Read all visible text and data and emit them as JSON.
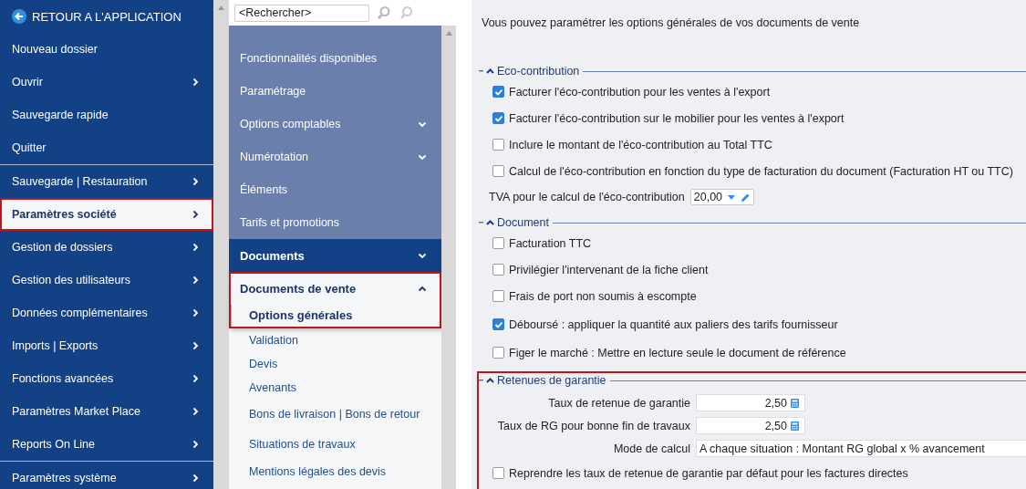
{
  "app_menu": {
    "back": "RETOUR A L'APPLICATION",
    "groups": [
      [
        {
          "label": "Nouveau dossier",
          "submenu": false,
          "selected": false,
          "highlighted": false
        },
        {
          "label": "Ouvrir",
          "submenu": true,
          "selected": false,
          "highlighted": false
        },
        {
          "label": "Sauvegarde rapide",
          "submenu": false,
          "selected": false,
          "highlighted": false
        },
        {
          "label": "Quitter",
          "submenu": false,
          "selected": false,
          "highlighted": false
        }
      ],
      [
        {
          "label": "Sauvegarde | Restauration",
          "submenu": true,
          "selected": false,
          "highlighted": false
        },
        {
          "label": "Paramètres société",
          "submenu": true,
          "selected": true,
          "highlighted": true
        },
        {
          "label": "Gestion de dossiers",
          "submenu": true,
          "selected": false,
          "highlighted": false
        },
        {
          "label": "Gestion des utilisateurs",
          "submenu": true,
          "selected": false,
          "highlighted": false
        },
        {
          "label": "Données complémentaires",
          "submenu": true,
          "selected": false,
          "highlighted": false
        },
        {
          "label": "Imports | Exports",
          "submenu": true,
          "selected": false,
          "highlighted": false
        },
        {
          "label": "Fonctions avancées",
          "submenu": true,
          "selected": false,
          "highlighted": false
        },
        {
          "label": "Paramètres Market Place",
          "submenu": true,
          "selected": false,
          "highlighted": false
        },
        {
          "label": "Reports On Line",
          "submenu": true,
          "selected": false,
          "highlighted": false
        }
      ],
      [
        {
          "label": "Paramètres système",
          "submenu": true,
          "selected": false,
          "highlighted": false
        }
      ]
    ]
  },
  "settings_tree": {
    "search": {
      "placeholder": "<Rechercher>"
    },
    "items": [
      {
        "label": "Fonctionnalités disponibles",
        "expanded": false,
        "has_children": false
      },
      {
        "label": "Paramétrage",
        "expanded": false,
        "has_children": false
      },
      {
        "label": "Options comptables",
        "expanded": false,
        "has_children": true
      },
      {
        "label": "Numérotation",
        "expanded": false,
        "has_children": true
      },
      {
        "label": "Éléments",
        "expanded": false,
        "has_children": false
      },
      {
        "label": "Tarifs et promotions",
        "expanded": false,
        "has_children": false
      },
      {
        "label": "Documents",
        "expanded": true,
        "has_children": true,
        "children": [
          {
            "label": "Documents de vente",
            "expanded": true,
            "highlighted": true,
            "children": [
              {
                "label": "Options générales",
                "selected": true
              },
              {
                "label": "Validation",
                "selected": false
              },
              {
                "label": "Devis",
                "selected": false
              },
              {
                "label": "Avenants",
                "selected": false
              },
              {
                "label": "Bons de livraison | Bons de retour",
                "selected": false
              },
              {
                "label": "Situations de travaux",
                "selected": false
              },
              {
                "label": "Mentions légales des devis",
                "selected": false
              }
            ]
          }
        ]
      }
    ]
  },
  "content": {
    "intro": "Vous pouvez paramétrer les options générales de vos documents de vente",
    "sections": [
      {
        "title": "Eco-contribution",
        "expanded": true,
        "highlighted": false,
        "rows": [
          {
            "kind": "checkbox",
            "label": "Facturer l'éco-contribution pour les ventes à l'export",
            "checked": true
          },
          {
            "kind": "checkbox",
            "label": "Facturer l'éco-contribution sur le mobilier pour les ventes à l'export",
            "checked": true
          },
          {
            "kind": "checkbox",
            "label": "Inclure le montant de l'éco-contribution au Total TTC",
            "checked": false
          },
          {
            "kind": "checkbox",
            "label": "Calcul de l'éco-contribution en fonction du type de facturation du document (Facturation HT ou TTC)",
            "checked": false
          },
          {
            "kind": "rate-select",
            "label": "TVA pour le calcul de l'éco-contribution",
            "value": "20,00"
          }
        ]
      },
      {
        "title": "Document",
        "expanded": true,
        "highlighted": false,
        "rows": [
          {
            "kind": "checkbox",
            "label": "Facturation TTC",
            "checked": false
          },
          {
            "kind": "checkbox",
            "label": "Privilégier l'intervenant de la fiche client",
            "checked": false
          },
          {
            "kind": "checkbox",
            "label": "Frais de port non soumis à escompte",
            "checked": false
          },
          {
            "kind": "checkbox",
            "label": "Déboursé : appliquer la quantité aux paliers des tarifs fournisseur",
            "checked": true
          },
          {
            "kind": "checkbox",
            "label": "Figer le marché : Mettre en lecture seule le document de référence",
            "checked": false
          }
        ]
      },
      {
        "title": "Retenues de garantie",
        "expanded": true,
        "highlighted": true,
        "rows": [
          {
            "kind": "number",
            "label": "Taux de retenue de garantie",
            "value": "2,50"
          },
          {
            "kind": "number",
            "label": "Taux de RG pour bonne fin de travaux",
            "value": "2,50"
          },
          {
            "kind": "select",
            "label": "Mode de calcul",
            "value": "A chaque situation : Montant RG global x % avancement"
          },
          {
            "kind": "checkbox",
            "label": "Reprendre les taux de retenue de garantie par défaut pour les factures directes",
            "checked": false
          }
        ]
      }
    ]
  }
}
